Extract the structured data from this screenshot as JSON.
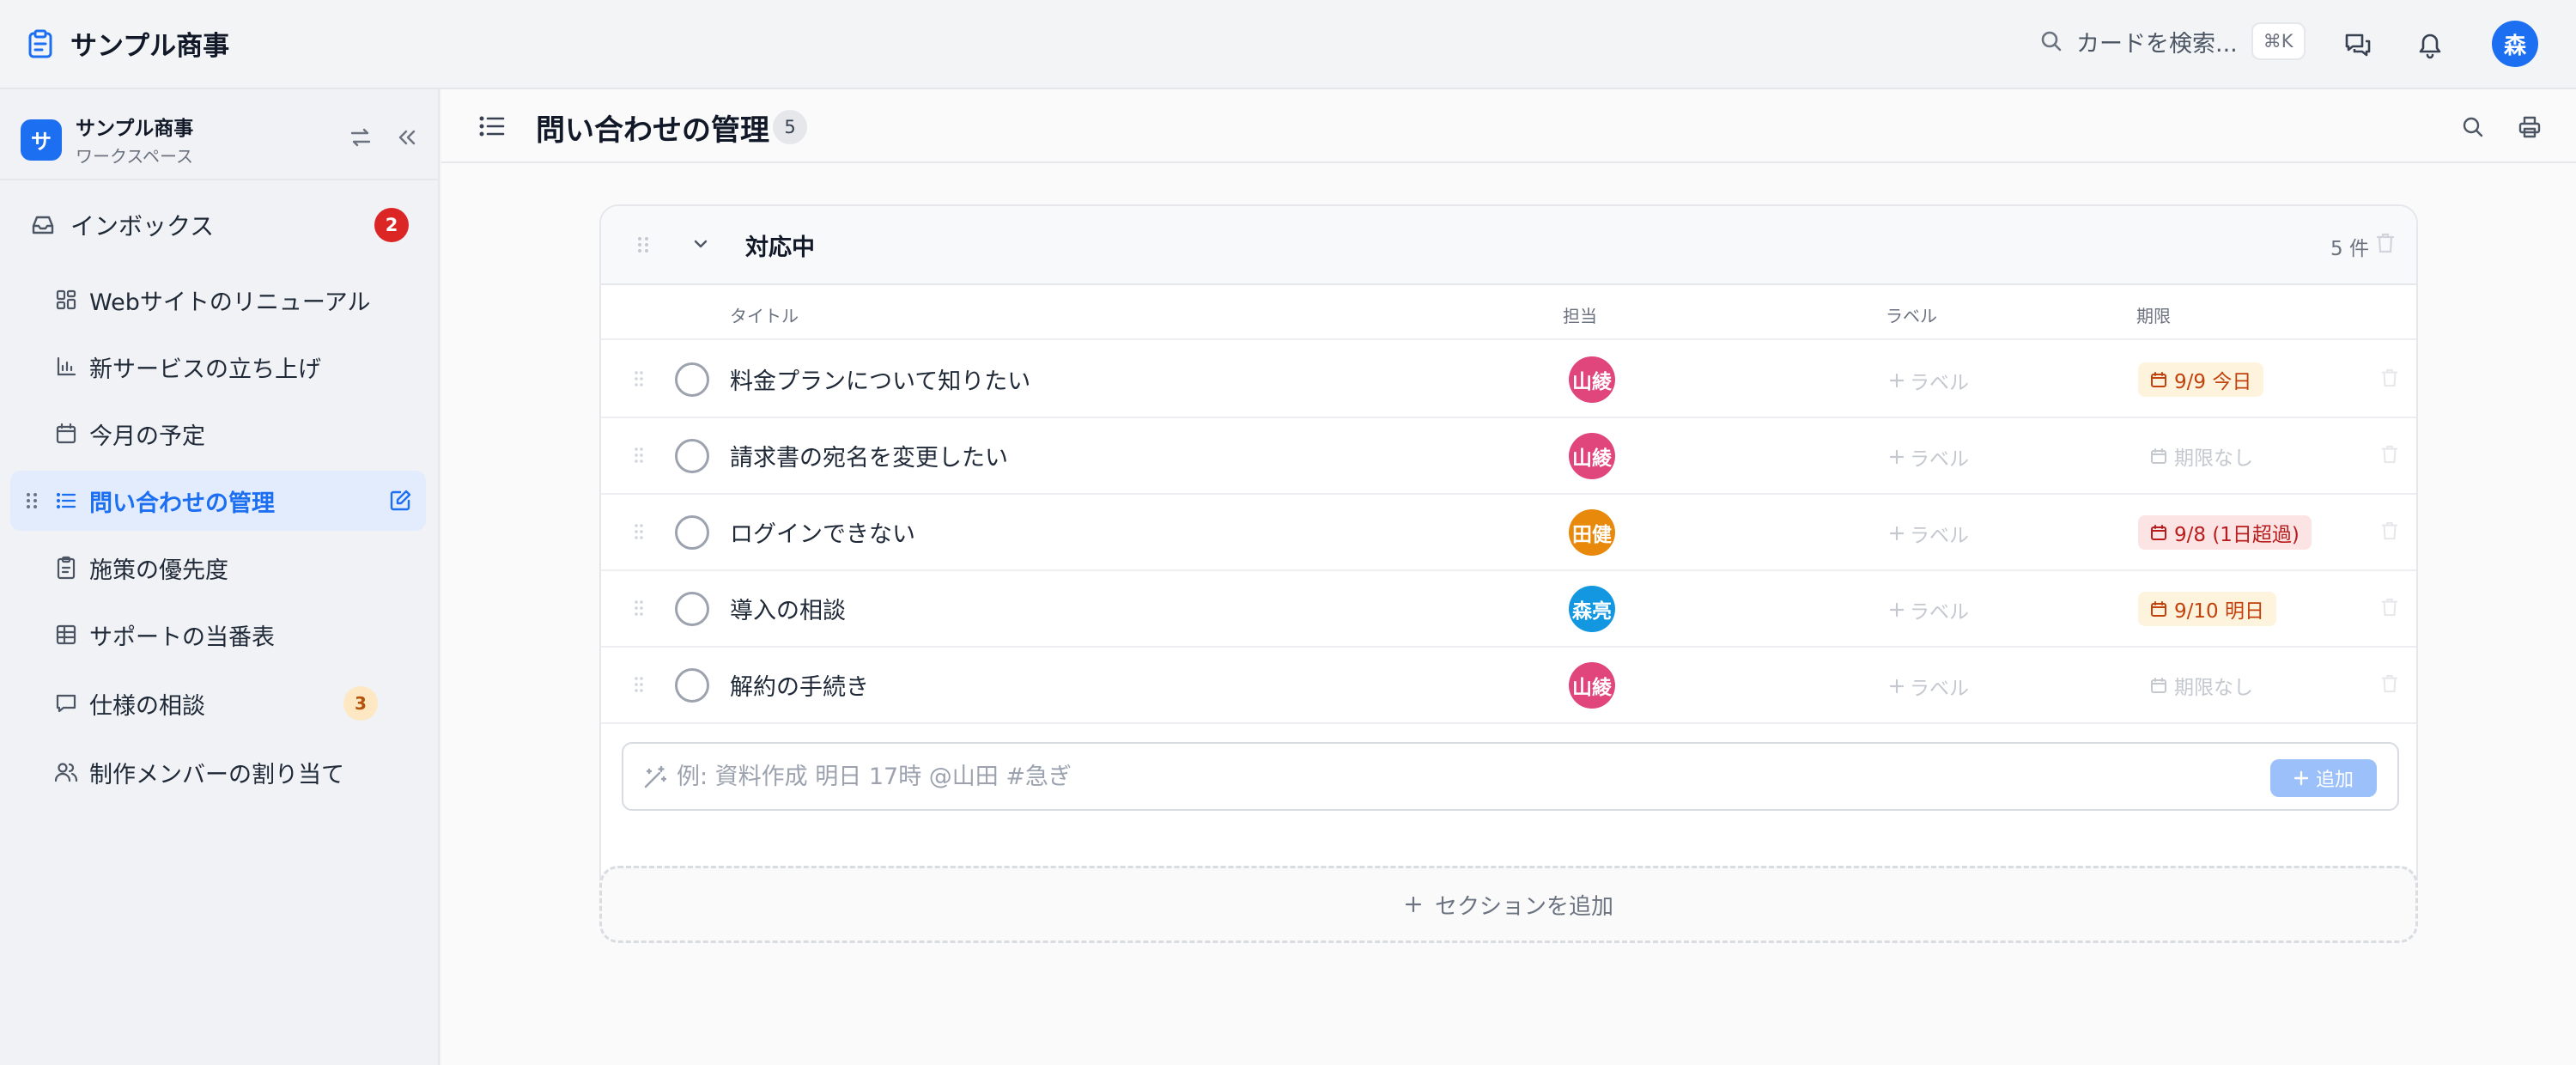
{
  "app": {
    "name": "サンプル商事"
  },
  "top_search": {
    "placeholder": "カードを検索...",
    "shortcut": "⌘K"
  },
  "user": {
    "initial": "森"
  },
  "workspace": {
    "name": "サンプル商事",
    "subtitle": "ワークスペース",
    "logo": "サ"
  },
  "inbox": {
    "label": "インボックス",
    "count": "2"
  },
  "nav": [
    {
      "label": "Webサイトのリニューアル",
      "icon": "dashboard-icon"
    },
    {
      "label": "新サービスの立ち上げ",
      "icon": "chart-icon"
    },
    {
      "label": "今月の予定",
      "icon": "calendar-icon"
    },
    {
      "label": "問い合わせの管理",
      "icon": "list-icon",
      "active": true
    },
    {
      "label": "施策の優先度",
      "icon": "clipboard-icon"
    },
    {
      "label": "サポートの当番表",
      "icon": "table-icon"
    },
    {
      "label": "仕様の相談",
      "icon": "chat-icon",
      "badge": "3"
    },
    {
      "label": "制作メンバーの割り当て",
      "icon": "users-icon"
    }
  ],
  "page": {
    "title": "問い合わせの管理",
    "count": "5"
  },
  "section": {
    "title": "対応中",
    "count": "5 件",
    "columns": {
      "title": "タイトル",
      "assignee": "担当",
      "label": "ラベル",
      "due": "期限"
    },
    "rows": [
      {
        "title": "料金プランについて知りたい",
        "assignee": "山綾",
        "assignee_color": "#e0457b",
        "label": "ラベル",
        "due": "9/9 今日",
        "due_status": "today"
      },
      {
        "title": "請求書の宛名を変更したい",
        "assignee": "山綾",
        "assignee_color": "#e0457b",
        "label": "ラベル",
        "due": "期限なし",
        "due_status": "none"
      },
      {
        "title": "ログインできない",
        "assignee": "田健",
        "assignee_color": "#e8890c",
        "label": "ラベル",
        "due": "9/8 (1日超過)",
        "due_status": "overdue"
      },
      {
        "title": "導入の相談",
        "assignee": "森亮",
        "assignee_color": "#1297e0",
        "label": "ラベル",
        "due": "9/10 明日",
        "due_status": "tomorrow"
      },
      {
        "title": "解約の手続き",
        "assignee": "山綾",
        "assignee_color": "#e0457b",
        "label": "ラベル",
        "due": "期限なし",
        "due_status": "none"
      }
    ],
    "add_input": {
      "placeholder": "例: 資料作成 明日 17時 @山田 #急ぎ",
      "value": ""
    },
    "add_button": "追加"
  },
  "add_section": "セクションを追加",
  "colors": {
    "accent": "#1d6ff2",
    "danger": "#dc2626",
    "warning_bg": "#fef3dc",
    "overdue_bg": "#fde4e4"
  }
}
